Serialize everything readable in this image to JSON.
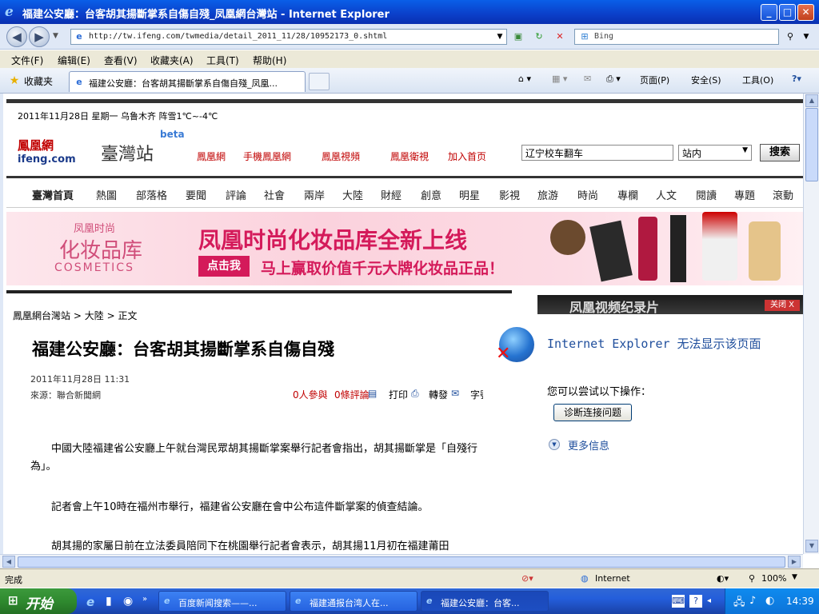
{
  "window": {
    "title": "福建公安廳：台客胡其揚斷掌系自傷自殘_凤凰網台灣站 - Internet Explorer"
  },
  "navbar": {
    "url": "http://tw.ifeng.com/twmedia/detail_2011_11/28/10952173_0.shtml",
    "search_placeholder": "Bing"
  },
  "menubar": [
    "文件(F)",
    "编辑(E)",
    "查看(V)",
    "收藏夹(A)",
    "工具(T)",
    "帮助(H)"
  ],
  "favbar": {
    "favorites_label": "收藏夹",
    "tab_title": "福建公安廳：台客胡其揚斷掌系自傷自殘_凤凰...",
    "page_menu": "页面(P)",
    "safety_menu": "安全(S)",
    "tools_menu": "工具(O)"
  },
  "page": {
    "date_line": "2011年11月28日  星期一   乌鲁木齐  阵雪1℃~-4℃",
    "logo_cn": "鳳凰網",
    "logo_en": "ifeng.com",
    "site_name": "臺灣站",
    "beta": "beta",
    "top_links": [
      "鳳凰網",
      "手機鳳凰網",
      "鳳凰視頻",
      "鳳凰衛視",
      "加入首页"
    ],
    "search_value": "辽宁校车翻车",
    "search_scope": "站内",
    "search_button": "搜索",
    "nav": [
      "臺灣首頁",
      "熱圖",
      "部落格",
      "要聞",
      "評論",
      "社會",
      "兩岸",
      "大陸",
      "財經",
      "創意",
      "明星",
      "影視",
      "旅游",
      "時尚",
      "專欄",
      "人文",
      "閱讀",
      "專題",
      "滾動"
    ],
    "banner": {
      "brand_top": "凤凰时尚",
      "brand_mid": "化妆品库",
      "brand_en": "COSMETICS",
      "headline": "凤凰时尚化妆品库全新上线",
      "cta": "点击我",
      "sub": "马上赢取价值千元大牌化妆品正品！"
    },
    "breadcrumb": [
      "鳳凰網台灣站",
      "大陸",
      "正文"
    ],
    "article": {
      "title": "福建公安廳：台客胡其揚斷掌系自傷自殘",
      "date": "2011年11月28日  11:31",
      "source": "來源：聯合新聞網",
      "participants": "0人參與",
      "comments": "0條評論",
      "print": "打印",
      "forward": "轉發",
      "font": "字號",
      "paragraphs": [
        "中國大陸福建省公安廳上午就台灣民眾胡其揚斷掌案舉行記者會指出，胡其揚斷掌是「自殘行為」。",
        "記者會上午10時在福州市舉行，福建省公安廳在會中公布這件斷掌案的偵查結論。",
        "胡其揚的家屬日前在立法委員陪同下在桃園舉行記者會表示，胡其揚11月初在福建莆田"
      ]
    },
    "video_bar": "凤凰视频纪录片",
    "video_close": "关闭 X",
    "ie_error": {
      "title": "Internet Explorer 无法显示该页面",
      "hint": "您可以尝试以下操作：",
      "diagnose": "诊断连接问题",
      "more": "更多信息"
    }
  },
  "statusbar": {
    "left": "完成",
    "zone": "Internet",
    "zoom": "100%"
  },
  "taskbar": {
    "start": "开始",
    "items": [
      "百度新闻搜索——...",
      "福建通报台湾人在...",
      "福建公安廳：台客..."
    ],
    "time": "14:39"
  }
}
